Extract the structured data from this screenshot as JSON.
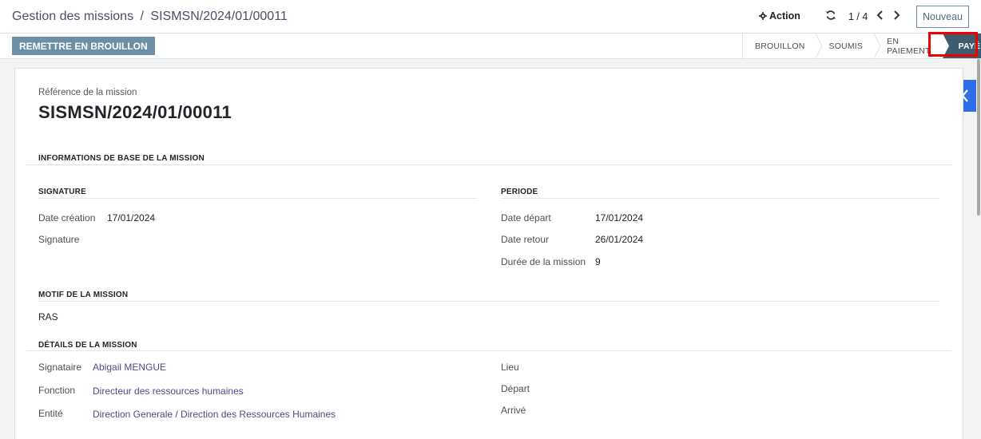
{
  "breadcrumb": {
    "parent": "Gestion des missions",
    "separator": "/",
    "current": "SISMSN/2024/01/00011"
  },
  "toolbar": {
    "action_label": "Action",
    "pager": "1 / 4",
    "new_label": "Nouveau"
  },
  "statusbar": {
    "draft_button": "REMETTRE EN BROUILLON",
    "stages": [
      "BROUILLON",
      "SOUMIS",
      "EN PAIEMENT",
      "PAYÉ"
    ],
    "active_stage": "PAYÉ"
  },
  "mission": {
    "ref_label": "Référence de la mission",
    "ref_value": "SISMSN/2024/01/00011",
    "section_base": "INFORMATIONS DE BASE DE LA MISSION",
    "signature_group": {
      "title": "SIGNATURE",
      "date_creation_label": "Date création",
      "date_creation": "17/01/2024",
      "signature_label": "Signature"
    },
    "periode_group": {
      "title": "PERIODE",
      "date_depart_label": "Date départ",
      "date_depart": "17/01/2024",
      "date_retour_label": "Date retour",
      "date_retour": "26/01/2024",
      "duree_label": "Durée de la mission",
      "duree": "9"
    },
    "motif": {
      "title": "MOTIF DE LA MISSION",
      "value": "RAS"
    },
    "details": {
      "title": "DÉTAILS DE LA MISSION",
      "signataire_label": "Signataire",
      "signataire": "Abigail MENGUE",
      "fonction_label": "Fonction",
      "fonction": "Directeur des ressources humaines",
      "entite_label": "Entité",
      "entite": "Direction Generale / Direction des Ressources Humaines",
      "lieu_label": "Lieu",
      "depart_label": "Départ",
      "arrive_label": "Arrivé"
    }
  },
  "colors": {
    "draft_button": "#6d8fa6",
    "active_stage": "#3f5c6e",
    "highlight": "#ee0000",
    "chatter_toggle": "#2f6fe6",
    "link": "#4b4b85"
  },
  "icons": [
    "gear-icon",
    "refresh-icon",
    "chevron-left-icon",
    "chevron-right-icon",
    "chevron-left-chatter-icon"
  ]
}
